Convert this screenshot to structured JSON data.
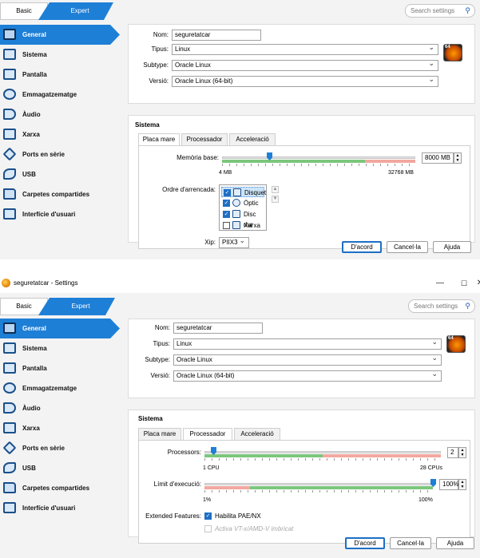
{
  "colors": {
    "accent": "#1e7fd6",
    "green_range": "#7cc67c",
    "red_range": "#f2a8a0"
  },
  "top_panel": {
    "modes": {
      "basic": "Basic",
      "expert": "Expert"
    },
    "search_placeholder": "Search settings",
    "sidebar": [
      {
        "label": "General",
        "icon": "general-icon"
      },
      {
        "label": "Sistema",
        "icon": "system-icon"
      },
      {
        "label": "Pantalla",
        "icon": "display-icon"
      },
      {
        "label": "Emmagatzematge",
        "icon": "storage-icon"
      },
      {
        "label": "Àudio",
        "icon": "audio-icon"
      },
      {
        "label": "Xarxa",
        "icon": "network-icon"
      },
      {
        "label": "Ports en sèrie",
        "icon": "serial-ports-icon"
      },
      {
        "label": "USB",
        "icon": "usb-icon"
      },
      {
        "label": "Carpetes compartides",
        "icon": "shared-folders-icon"
      },
      {
        "label": "Interfície d'usuari",
        "icon": "user-interface-icon"
      }
    ],
    "general": {
      "name_label": "Nom:",
      "name_value": "seguretatcar",
      "type_label": "Tipus:",
      "type_value": "Linux",
      "subtype_label": "Subtype:",
      "subtype_value": "Oracle Linux",
      "version_label": "Versió:",
      "version_value": "Oracle Linux (64-bit)",
      "os_badge": "64"
    },
    "system": {
      "title": "Sistema",
      "tabs": [
        "Placa mare",
        "Processador",
        "Acceleració"
      ],
      "memory_label": "Memòria base:",
      "memory_value": "8000 MB",
      "memory_min": "4 MB",
      "memory_max": "32768 MB",
      "memory_fraction": 0.244,
      "boot_label": "Ordre d'arrencada:",
      "boot_items": [
        {
          "label": "Disquet",
          "checked": true,
          "selected": true
        },
        {
          "label": "Òptic",
          "checked": true,
          "selected": false
        },
        {
          "label": "Disc dur",
          "checked": true,
          "selected": false
        },
        {
          "label": "Xarxa",
          "checked": false,
          "selected": false
        }
      ],
      "chipset_label": "Xip:",
      "chipset_value": "PIIX3"
    },
    "buttons": {
      "ok": "D'acord",
      "cancel": "Cancel·la",
      "help": "Ajuda"
    }
  },
  "bottom_panel": {
    "window_title": "seguretatcar - Settings",
    "window_controls": {
      "minimize": "—",
      "maximize": "☐",
      "close": "✕"
    },
    "modes": {
      "basic": "Basic",
      "expert": "Expert"
    },
    "search_placeholder": "Search settings",
    "sidebar": [
      {
        "label": "General",
        "icon": "general-icon"
      },
      {
        "label": "Sistema",
        "icon": "system-icon"
      },
      {
        "label": "Pantalla",
        "icon": "display-icon"
      },
      {
        "label": "Emmagatzematge",
        "icon": "storage-icon"
      },
      {
        "label": "Àudio",
        "icon": "audio-icon"
      },
      {
        "label": "Xarxa",
        "icon": "network-icon"
      },
      {
        "label": "Ports en sèrie",
        "icon": "serial-ports-icon"
      },
      {
        "label": "USB",
        "icon": "usb-icon"
      },
      {
        "label": "Carpetes compartides",
        "icon": "shared-folders-icon"
      },
      {
        "label": "Interfície d'usuari",
        "icon": "user-interface-icon"
      }
    ],
    "general": {
      "name_label": "Nom:",
      "name_value": "seguretatcar",
      "type_label": "Tipus:",
      "type_value": "Linux",
      "subtype_label": "Subtype:",
      "subtype_value": "Oracle Linux",
      "version_label": "Versió:",
      "version_value": "Oracle Linux (64-bit)",
      "os_badge": "64"
    },
    "system": {
      "title": "Sistema",
      "tabs": [
        "Placa mare",
        "Processador",
        "Acceleració"
      ],
      "processors_label": "Processors:",
      "processors_value": "2",
      "processors_min": "1 CPU",
      "processors_max": "28 CPUs",
      "processors_fraction": 0.037,
      "cap_label": "Límit d'execució:",
      "cap_value": "100%",
      "cap_min": "1%",
      "cap_max": "100%",
      "cap_fraction": 1.0,
      "ext_label": "Extended Features:",
      "pae_label": "Habilita PAE/NX",
      "pae_checked": true,
      "vtx_label": "Activa VT-x/AMD-V imbricat",
      "vtx_checked": false
    },
    "buttons": {
      "ok": "D'acord",
      "cancel": "Cancel·la",
      "help": "Ajuda"
    }
  }
}
